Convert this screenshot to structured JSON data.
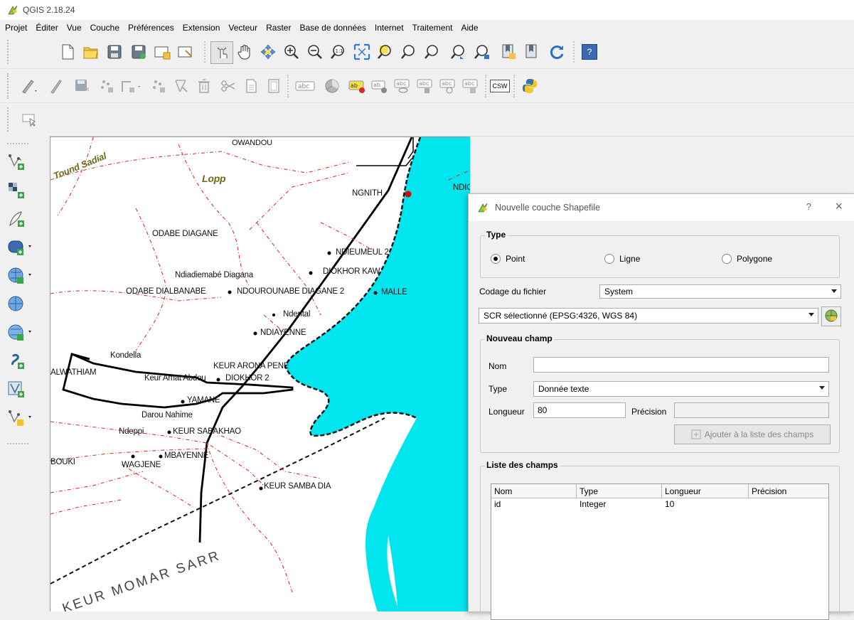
{
  "app": {
    "title": "QGIS 2.18.24"
  },
  "menu": [
    "Projet",
    "Éditer",
    "Vue",
    "Couche",
    "Préférences",
    "Extension",
    "Vecteur",
    "Raster",
    "Base de données",
    "Internet",
    "Traitement",
    "Aide"
  ],
  "toolbar": {
    "row1": [
      "new-project-icon",
      "open-project-icon",
      "save-project-icon",
      "save-as-icon",
      "new-print-composer-icon",
      "composer-manager-icon",
      "touch-zoom-icon",
      "pan-icon",
      "pan-to-selection-icon",
      "zoom-in-icon",
      "zoom-out-icon",
      "zoom-native-icon",
      "zoom-full-icon",
      "zoom-to-selection-icon",
      "zoom-to-layer-icon",
      "zoom-last-icon",
      "zoom-next-icon",
      "new-bookmark-icon",
      "show-bookmarks-icon",
      "refresh-icon",
      "help-icon"
    ],
    "row2": [
      "current-edits-icon",
      "toggle-editing-icon",
      "save-edits-icon",
      "add-feature-icon",
      "move-feature-icon",
      "node-tool-icon",
      "delete-selected-icon",
      "cut-features-icon",
      "copy-features-icon",
      "paste-features-icon",
      "label-toolbar-icon",
      "diagram-icon",
      "layer-labeling-icon",
      "pin-labels-icon",
      "show-hide-labels-icon",
      "move-label-icon",
      "rotate-label-icon",
      "change-label-icon",
      "csw-icon",
      "python-icon"
    ],
    "csw_label": "CSW",
    "help_label": "?"
  },
  "map": {
    "labels": [
      "Tound Sadial",
      "Lopp",
      "OWANDOU",
      "NGNITH",
      "NDIOKHOR ILE",
      "ODABE DIAGANE",
      "NDIEUMEUL 2",
      "DIOKHOR KAW",
      "Ndiadiemabé Diagana",
      "ODABE DIALBANABE",
      "NDOUROUNABE DIAGANE 2",
      "MALLE",
      "Ndental",
      "NDIAYENNE",
      "Kondella",
      "ALWATHIAM",
      "KEUR ARONA PENE",
      "Keur Amat Abdou",
      "DIOKHOR 2",
      "YAMANE",
      "Darou Nahime",
      "Ndeppi",
      "KEUR SABAKHAO",
      "BOUKI",
      "WAGJENE",
      "MBAYENNE",
      "KEUR SAMBA DIA",
      "KEUR MOMAR SARR"
    ]
  },
  "dialog": {
    "title": "Nouvelle couche Shapefile",
    "help": "?",
    "close": "×",
    "type_group": "Type",
    "radios": [
      {
        "label": "Point",
        "checked": true
      },
      {
        "label": "Ligne",
        "checked": false
      },
      {
        "label": "Polygone",
        "checked": false
      }
    ],
    "encoding_label": "Codage du fichier",
    "encoding_value": "System",
    "crs_value": "SCR sélectionné (EPSG:4326, WGS 84)",
    "new_field_group": "Nouveau champ",
    "name_label": "Nom",
    "name_value": "",
    "type_label": "Type",
    "type_value": "Donnée texte",
    "length_label": "Longueur",
    "length_value": "80",
    "precision_label": "Précision",
    "precision_value": "",
    "add_button": "Ajouter à la liste des champs",
    "fields_group": "Liste des champs",
    "table": {
      "headers": [
        "Nom",
        "Type",
        "Longueur",
        "Précision"
      ],
      "rows": [
        [
          "id",
          "Integer",
          "10",
          ""
        ]
      ]
    }
  },
  "colors": {
    "water": "#00e5ee",
    "roads": "#000000",
    "tracks": "#e02020",
    "label_lopp": "#6b6b1a"
  }
}
